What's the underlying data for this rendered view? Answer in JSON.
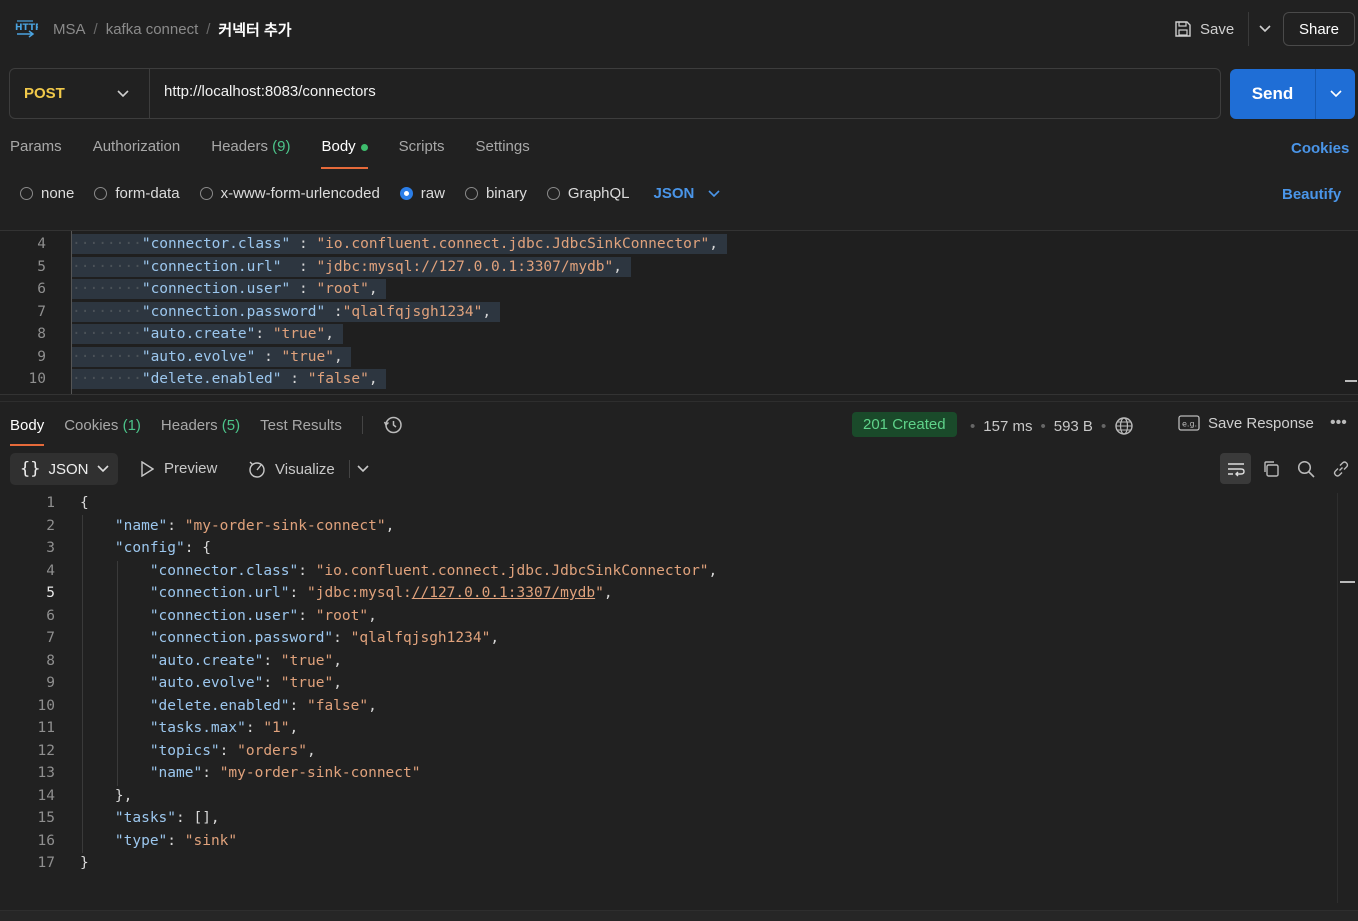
{
  "breadcrumb": {
    "items": [
      "MSA",
      "kafka connect"
    ],
    "current": "커넥터 추가"
  },
  "header": {
    "save_label": "Save",
    "share_label": "Share"
  },
  "request": {
    "method": "POST",
    "url": "http://localhost:8083/connectors",
    "send_label": "Send",
    "tabs": [
      {
        "label": "Params"
      },
      {
        "label": "Authorization"
      },
      {
        "label": "Headers",
        "count": "(9)"
      },
      {
        "label": "Body"
      },
      {
        "label": "Scripts"
      },
      {
        "label": "Settings"
      }
    ],
    "cookies_label": "Cookies",
    "body_types": [
      "none",
      "form-data",
      "x-www-form-urlencoded",
      "raw",
      "binary",
      "GraphQL"
    ],
    "selected_body_type": "raw",
    "raw_format": "JSON",
    "beautify_label": "Beautify",
    "editor_lines": [
      {
        "n": "4",
        "k": "\"connector.class\"",
        "sep": " : ",
        "v": "\"io.confluent.connect.jdbc.JdbcSinkConnector\"",
        "end": ","
      },
      {
        "n": "5",
        "k": "\"connection.url\"",
        "sep": "  : ",
        "v": "\"jdbc:mysql://127.0.0.1:3307/mydb\"",
        "end": ","
      },
      {
        "n": "6",
        "k": "\"connection.user\"",
        "sep": " : ",
        "v": "\"root\"",
        "end": ","
      },
      {
        "n": "7",
        "k": "\"connection.password\"",
        "sep": " :",
        "v": "\"qlalfqjsgh1234\"",
        "end": ","
      },
      {
        "n": "8",
        "k": "\"auto.create\"",
        "sep": ": ",
        "v": "\"true\"",
        "end": ","
      },
      {
        "n": "9",
        "k": "\"auto.evolve\"",
        "sep": " : ",
        "v": "\"true\"",
        "end": ","
      },
      {
        "n": "10",
        "k": "\"delete.enabled\"",
        "sep": " : ",
        "v": "\"false\"",
        "end": ","
      }
    ]
  },
  "response": {
    "tabs": [
      {
        "label": "Body"
      },
      {
        "label": "Cookies",
        "count": "(1)"
      },
      {
        "label": "Headers",
        "count": "(5)"
      },
      {
        "label": "Test Results"
      }
    ],
    "status": "201 Created",
    "time": "157 ms",
    "size": "593 B",
    "save_response_label": "Save Response",
    "format": "JSON",
    "preview_label": "Preview",
    "visualize_label": "Visualize",
    "lines": [
      {
        "n": "1",
        "indent": 0,
        "parts": [
          [
            "punc",
            "{"
          ]
        ]
      },
      {
        "n": "2",
        "indent": 1,
        "parts": [
          [
            "key",
            "\"name\""
          ],
          [
            "punc",
            ": "
          ],
          [
            "str",
            "\"my-order-sink-connect\""
          ],
          [
            "punc",
            ","
          ]
        ]
      },
      {
        "n": "3",
        "indent": 1,
        "parts": [
          [
            "key",
            "\"config\""
          ],
          [
            "punc",
            ": {"
          ]
        ]
      },
      {
        "n": "4",
        "indent": 2,
        "parts": [
          [
            "key",
            "\"connector.class\""
          ],
          [
            "punc",
            ": "
          ],
          [
            "str",
            "\"io.confluent.connect.jdbc.JdbcSinkConnector\""
          ],
          [
            "punc",
            ","
          ]
        ]
      },
      {
        "n": "5",
        "indent": 2,
        "parts": [
          [
            "key",
            "\"connection.url\""
          ],
          [
            "punc",
            ": "
          ],
          [
            "str",
            "\"jdbc:mysql:"
          ],
          [
            "stru",
            "//127.0.0.1:3307/mydb"
          ],
          [
            "str",
            "\""
          ],
          [
            "punc",
            ","
          ]
        ]
      },
      {
        "n": "6",
        "indent": 2,
        "parts": [
          [
            "key",
            "\"connection.user\""
          ],
          [
            "punc",
            ": "
          ],
          [
            "str",
            "\"root\""
          ],
          [
            "punc",
            ","
          ]
        ]
      },
      {
        "n": "7",
        "indent": 2,
        "parts": [
          [
            "key",
            "\"connection.password\""
          ],
          [
            "punc",
            ": "
          ],
          [
            "str",
            "\"qlalfqjsgh1234\""
          ],
          [
            "punc",
            ","
          ]
        ]
      },
      {
        "n": "8",
        "indent": 2,
        "parts": [
          [
            "key",
            "\"auto.create\""
          ],
          [
            "punc",
            ": "
          ],
          [
            "str",
            "\"true\""
          ],
          [
            "punc",
            ","
          ]
        ]
      },
      {
        "n": "9",
        "indent": 2,
        "parts": [
          [
            "key",
            "\"auto.evolve\""
          ],
          [
            "punc",
            ": "
          ],
          [
            "str",
            "\"true\""
          ],
          [
            "punc",
            ","
          ]
        ]
      },
      {
        "n": "10",
        "indent": 2,
        "parts": [
          [
            "key",
            "\"delete.enabled\""
          ],
          [
            "punc",
            ": "
          ],
          [
            "str",
            "\"false\""
          ],
          [
            "punc",
            ","
          ]
        ]
      },
      {
        "n": "11",
        "indent": 2,
        "parts": [
          [
            "key",
            "\"tasks.max\""
          ],
          [
            "punc",
            ": "
          ],
          [
            "str",
            "\"1\""
          ],
          [
            "punc",
            ","
          ]
        ]
      },
      {
        "n": "12",
        "indent": 2,
        "parts": [
          [
            "key",
            "\"topics\""
          ],
          [
            "punc",
            ": "
          ],
          [
            "str",
            "\"orders\""
          ],
          [
            "punc",
            ","
          ]
        ]
      },
      {
        "n": "13",
        "indent": 2,
        "parts": [
          [
            "key",
            "\"name\""
          ],
          [
            "punc",
            ": "
          ],
          [
            "str",
            "\"my-order-sink-connect\""
          ]
        ]
      },
      {
        "n": "14",
        "indent": 1,
        "parts": [
          [
            "punc",
            "},"
          ]
        ]
      },
      {
        "n": "15",
        "indent": 1,
        "parts": [
          [
            "key",
            "\"tasks\""
          ],
          [
            "punc",
            ": [],"
          ]
        ]
      },
      {
        "n": "16",
        "indent": 1,
        "parts": [
          [
            "key",
            "\"type\""
          ],
          [
            "punc",
            ": "
          ],
          [
            "str",
            "\"sink\""
          ]
        ]
      },
      {
        "n": "17",
        "indent": 0,
        "parts": [
          [
            "punc",
            "}"
          ]
        ]
      }
    ],
    "current_line": "5"
  }
}
